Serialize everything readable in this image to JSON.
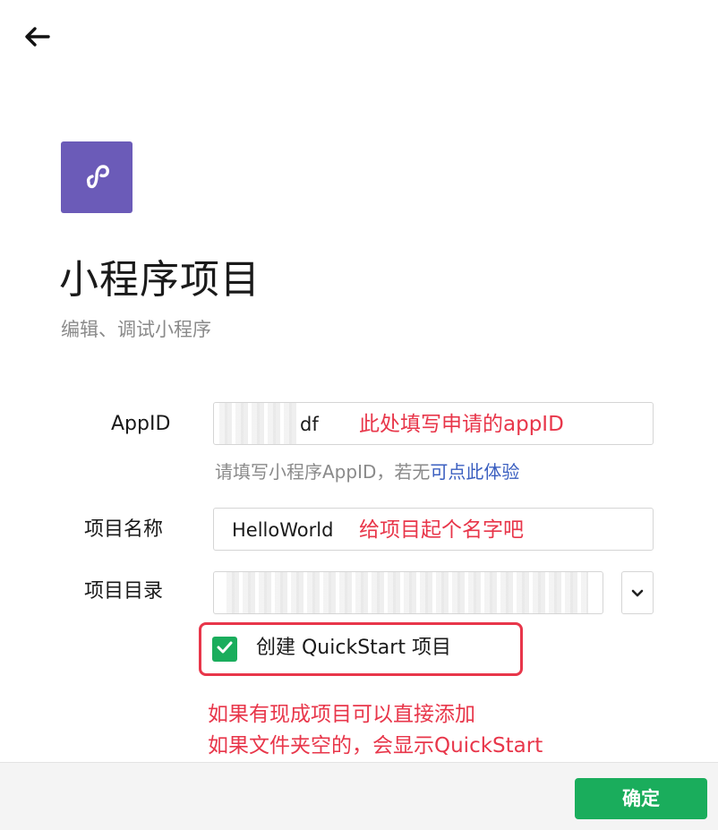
{
  "header": {
    "back_icon": "arrow-left-icon"
  },
  "logo": {
    "icon": "mini-program-logo-icon",
    "color": "#6b5bb8"
  },
  "page": {
    "title": "小程序项目",
    "subtitle": "编辑、调试小程序"
  },
  "form": {
    "appid": {
      "label": "AppID",
      "value_visible": "df",
      "annotation": "此处填写申请的appID"
    },
    "hint": {
      "text": "请填写小程序AppID，若无",
      "link": "可点此体验"
    },
    "project_name": {
      "label": "项目名称",
      "value": "HelloWorld",
      "annotation": "给项目起个名字吧"
    },
    "project_dir": {
      "label": "项目目录",
      "dropdown_icon": "chevron-down-icon"
    },
    "quickstart": {
      "label": "创建 QuickStart 项目",
      "checked": true
    }
  },
  "notes": {
    "line1": "如果有现成项目可以直接添加",
    "line2": "如果文件夹空的，会显示QuickStart"
  },
  "footer": {
    "confirm_label": "确定"
  },
  "colors": {
    "accent_green": "#1aad5c",
    "annotation_red": "#e8364a",
    "link_blue": "#3b5fc0"
  }
}
